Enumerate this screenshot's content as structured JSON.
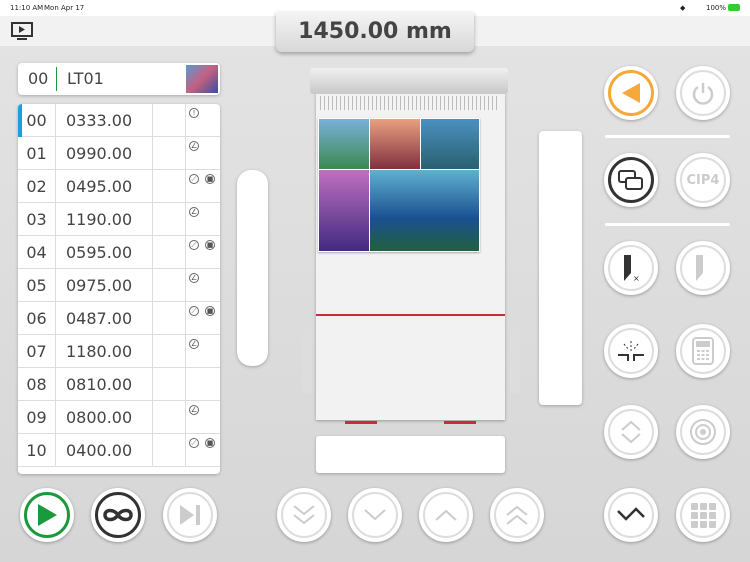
{
  "status": {
    "time": "11:10 AM",
    "date": "Mon Apr 17",
    "battery": "100%"
  },
  "readout": "1450.00 mm",
  "program": {
    "number": "00",
    "name": "LT01"
  },
  "rows": [
    {
      "n": "00",
      "v": "0333.00",
      "icons": [
        "alert"
      ]
    },
    {
      "n": "01",
      "v": "0990.00",
      "icons": [
        "knife"
      ]
    },
    {
      "n": "02",
      "v": "0495.00",
      "icons": [
        "link",
        "stop"
      ]
    },
    {
      "n": "03",
      "v": "1190.00",
      "icons": [
        "knife"
      ]
    },
    {
      "n": "04",
      "v": "0595.00",
      "icons": [
        "link",
        "stop"
      ]
    },
    {
      "n": "05",
      "v": "0975.00",
      "icons": [
        "knife"
      ]
    },
    {
      "n": "06",
      "v": "0487.00",
      "icons": [
        "link",
        "stop"
      ]
    },
    {
      "n": "07",
      "v": "1180.00",
      "icons": [
        "knife"
      ]
    },
    {
      "n": "08",
      "v": "0810.00",
      "icons": []
    },
    {
      "n": "09",
      "v": "0800.00",
      "icons": [
        "knife"
      ]
    },
    {
      "n": "10",
      "v": "0400.00",
      "icons": [
        "link",
        "stop"
      ]
    }
  ],
  "right_buttons": {
    "cip4": "CIP4"
  },
  "colors": {
    "accent": "#f6a83b",
    "play": "#1a9a3a",
    "selected": "#1aa0e0",
    "cutline": "#c0303a"
  }
}
